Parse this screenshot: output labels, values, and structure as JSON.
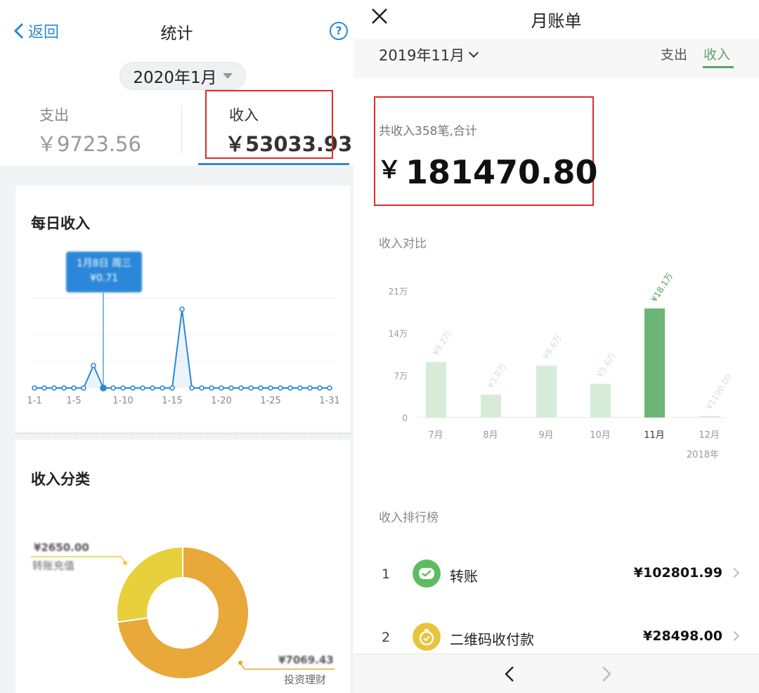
{
  "left": {
    "back_label": "返回",
    "title": "统计",
    "help_icon": "question-circle-icon",
    "month_selector": "2020年1月",
    "tabs": [
      {
        "label": "支出",
        "amount": "￥9723.56"
      },
      {
        "label": "收入",
        "amount": "￥53033.93"
      }
    ],
    "daily": {
      "title": "每日收入",
      "tooltip_date": "1月8日 周三",
      "tooltip_value": "¥0.71",
      "x_ticks": [
        "1-1",
        "1-5",
        "1-10",
        "1-15",
        "1-20",
        "1-25",
        "1-31"
      ]
    },
    "category": {
      "title": "收入分类",
      "slices": [
        {
          "label": "转账充值",
          "value": "¥2650.00",
          "amount": 2650.0,
          "color": "#e8cf3c"
        },
        {
          "label": "投资理财",
          "value": "¥7069.43",
          "amount": 7069.43,
          "color": "#e8a83a"
        }
      ]
    },
    "colors": {
      "accent": "#2b88d8",
      "highlight_box": "#e12a2a"
    }
  },
  "right": {
    "close_icon": "close-icon",
    "title": "月账单",
    "month_selector": "2019年11月",
    "tabs": [
      "支出",
      "收入"
    ],
    "summary_note": "共收入358笔,合计",
    "summary_currency": "￥",
    "summary_amount": "181470.80",
    "compare_title": "收入对比",
    "ranking_title": "收入排行榜",
    "year_label": "2018年",
    "ranking": [
      {
        "rank": "1",
        "name": "转账",
        "amount": "¥102801.99",
        "icon": "transfer-icon",
        "color": "#5bbd5f"
      },
      {
        "rank": "2",
        "name": "二维码收付款",
        "amount": "¥28498.00",
        "icon": "qr-payment-icon",
        "color": "#e8c43a"
      }
    ],
    "bottom_nav": {
      "prev_icon": "chevron-left-icon",
      "next_icon": "chevron-right-icon"
    },
    "colors": {
      "accent": "#5aa36a",
      "bar_light": "#d6ecd9",
      "bar_active": "#6bb676"
    }
  },
  "chart_data": [
    {
      "type": "line",
      "title": "每日收入",
      "x": [
        1,
        2,
        3,
        4,
        5,
        6,
        7,
        8,
        9,
        10,
        11,
        12,
        13,
        14,
        15,
        16,
        17,
        18,
        19,
        20,
        21,
        22,
        23,
        24,
        25,
        26,
        27,
        28,
        29,
        30,
        31
      ],
      "series": [
        {
          "values": [
            0,
            0,
            0,
            0,
            0,
            0,
            1.0,
            0,
            0,
            0,
            0,
            0,
            0,
            0,
            0,
            3.5,
            0,
            0,
            0,
            0,
            0,
            0,
            0,
            0,
            0,
            0,
            0,
            0,
            0,
            0,
            0
          ]
        }
      ],
      "xtick_labels": [
        "1-1",
        "1-5",
        "1-10",
        "1-15",
        "1-20",
        "1-25",
        "1-31"
      ],
      "tooltip": {
        "date": "1月8日 周三",
        "value": "¥0.71"
      },
      "grid": true
    },
    {
      "type": "pie",
      "title": "收入分类",
      "slices": [
        {
          "label": "转账充值",
          "value": 2650.0
        },
        {
          "label": "投资理财",
          "value": 7069.43
        }
      ],
      "donut": true
    },
    {
      "type": "bar",
      "title": "收入对比",
      "categories": [
        "7月",
        "8月",
        "9月",
        "10月",
        "11月",
        "12月"
      ],
      "values": [
        9.2,
        3.8,
        8.6,
        5.6,
        18.1,
        0.119
      ],
      "data_labels": [
        "¥9.2万",
        "¥3.8万",
        "¥8.6万",
        "¥5.6万",
        "¥18.1万",
        "¥1190.00"
      ],
      "highlight_index": 4,
      "ytick_labels": [
        "0",
        "7万",
        "14万",
        "21万"
      ],
      "ylim": [
        0,
        21
      ],
      "year_label": "2018年"
    }
  ]
}
